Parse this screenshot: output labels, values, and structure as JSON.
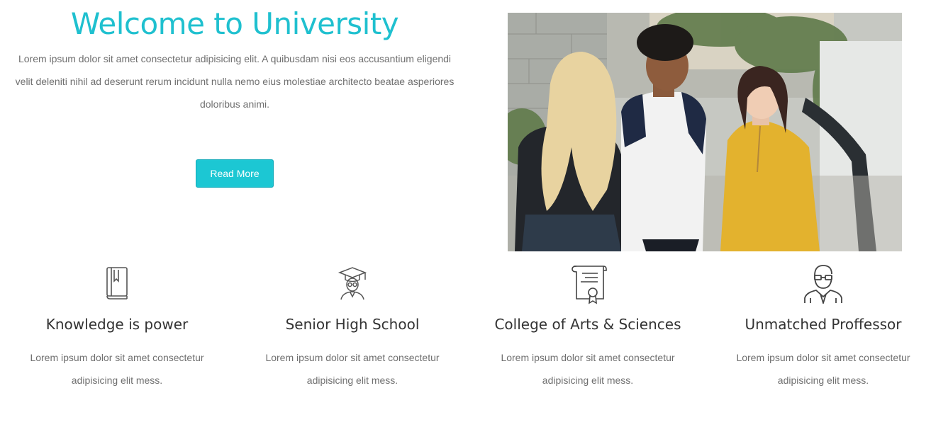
{
  "intro": {
    "title": "Welcome to University",
    "text": "Lorem ipsum dolor sit amet consectetur adipisicing elit. A quibusdam nisi eos accusantium eligendi velit deleniti nihil ad deserunt rerum incidunt nulla nemo eius molestiae architecto beatae asperiores doloribus animi.",
    "button_label": "Read More",
    "accent_color": "#1fc0cf",
    "button_color": "#1cc7d3"
  },
  "hero_image": {
    "icon": "students-photo"
  },
  "features": [
    {
      "icon": "book-icon",
      "title": "Knowledge is power",
      "text": "Lorem ipsum dolor sit amet consectetur adipisicing elit mess."
    },
    {
      "icon": "graduate-icon",
      "title": "Senior High School",
      "text": "Lorem ipsum dolor sit amet consectetur adipisicing elit mess."
    },
    {
      "icon": "certificate-icon",
      "title": "College of Arts & Sciences",
      "text": "Lorem ipsum dolor sit amet consectetur adipisicing elit mess."
    },
    {
      "icon": "professor-icon",
      "title": "Unmatched Proffessor",
      "text": "Lorem ipsum dolor sit amet consectetur adipisicing elit mess."
    }
  ]
}
